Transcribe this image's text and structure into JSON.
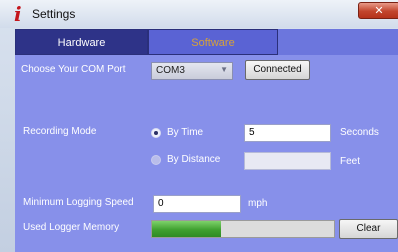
{
  "window": {
    "title": "Settings",
    "app_icon": "info-icon",
    "close_glyph": "✕"
  },
  "tabs": [
    {
      "label": "Hardware",
      "selected": true
    },
    {
      "label": "Software",
      "selected": false
    }
  ],
  "com_port": {
    "label": "Choose Your COM Port",
    "value": "COM3",
    "status_button": "Connected"
  },
  "recording": {
    "label": "Recording Mode",
    "by_time": {
      "label": "By Time",
      "selected": true,
      "value": "5",
      "unit": "Seconds"
    },
    "by_distance": {
      "label": "By Distance",
      "selected": false,
      "value": "",
      "unit": "Feet"
    }
  },
  "min_speed": {
    "label": "Minimum Logging Speed",
    "value": "0",
    "unit": "mph"
  },
  "memory": {
    "label": "Used Logger Memory",
    "used_fraction": 0.38,
    "clear_button": "Clear"
  }
}
